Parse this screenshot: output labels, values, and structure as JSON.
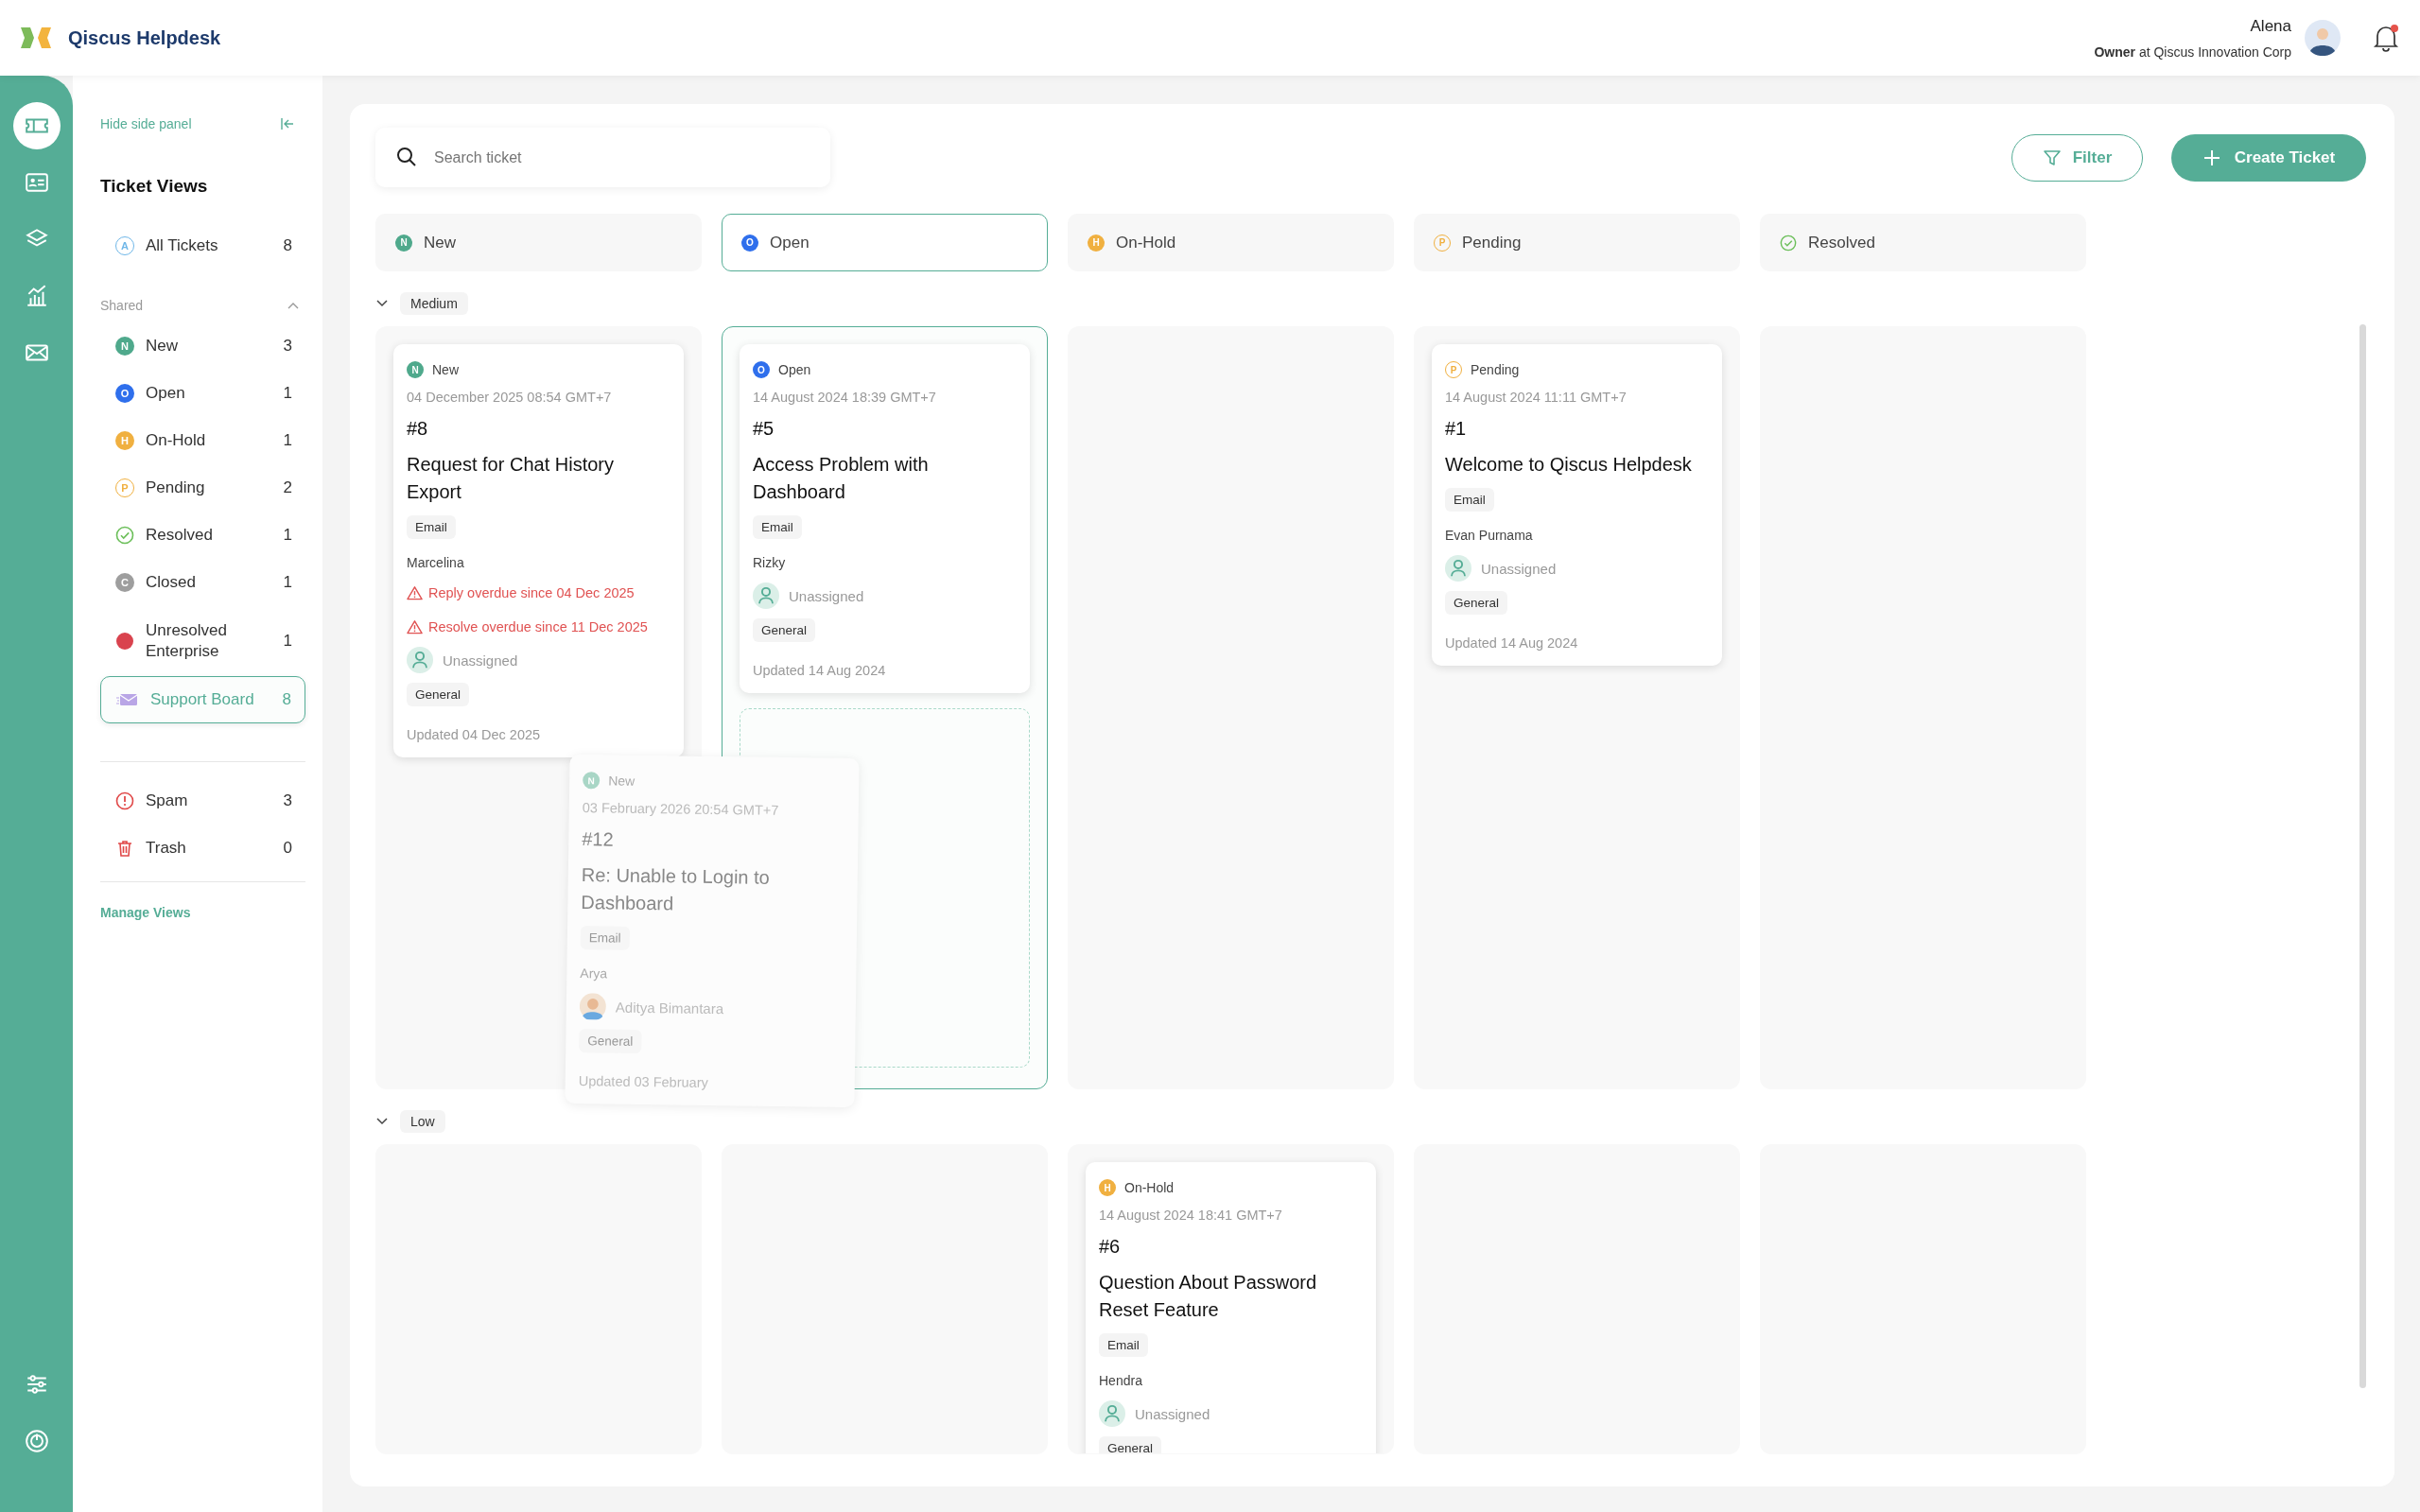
{
  "header": {
    "app_name": "Qiscus Helpdesk",
    "user_name": "Alena",
    "user_role": "**Owner** at Qiscus Innovation Corp",
    "notification_unread": true
  },
  "rail": {
    "items": [
      {
        "kind": "ticket",
        "selected": true
      },
      {
        "kind": "contacts",
        "selected": false
      },
      {
        "kind": "layers",
        "selected": false
      },
      {
        "kind": "chart",
        "selected": false
      },
      {
        "kind": "mail",
        "selected": false
      }
    ],
    "bottom": [
      {
        "kind": "settings"
      },
      {
        "kind": "power"
      }
    ]
  },
  "side_panel": {
    "hide_label": "Hide side panel",
    "title": "Ticket Views",
    "all_tickets": {
      "label": "All Tickets",
      "count": "8",
      "badge": {
        "kind": "outline",
        "letter": "A",
        "color": "#6fb7e8"
      }
    },
    "shared_label": "Shared",
    "shared_expanded": true,
    "views": [
      {
        "label": "New",
        "count": "3",
        "badge": {
          "kind": "filled",
          "letter": "N",
          "color": "#4fa98c"
        }
      },
      {
        "label": "Open",
        "count": "1",
        "badge": {
          "kind": "filled",
          "letter": "O",
          "color": "#2f6fec"
        }
      },
      {
        "label": "On-Hold",
        "count": "1",
        "badge": {
          "kind": "filled",
          "letter": "H",
          "color": "#f0b040"
        }
      },
      {
        "label": "Pending",
        "count": "2",
        "badge": {
          "kind": "outline",
          "letter": "P",
          "color": "#f0b040"
        }
      },
      {
        "label": "Resolved",
        "count": "1",
        "badge": {
          "kind": "check",
          "color": "#6cbf5a"
        }
      },
      {
        "label": "Closed",
        "count": "1",
        "badge": {
          "kind": "filled",
          "letter": "C",
          "color": "#9e9e9e"
        }
      },
      {
        "label": "Unresolved Enterprise",
        "count": "1",
        "badge": {
          "kind": "dot",
          "color": "#d9434e"
        }
      },
      {
        "label": "Support Board",
        "count": "8",
        "badge": {
          "kind": "board",
          "color": "#b9a6e6"
        },
        "selected": true
      }
    ],
    "other": [
      {
        "label": "Spam",
        "count": "3",
        "kind": "spam"
      },
      {
        "label": "Trash",
        "count": "0",
        "kind": "trash"
      }
    ],
    "manage_label": "Manage Views"
  },
  "toolbar": {
    "search": {
      "placeholder": "Search ticket"
    },
    "filter_label": "Filter",
    "create_label": "Create Ticket"
  },
  "columns": [
    {
      "label": "New",
      "selected": false,
      "badge": {
        "kind": "filled",
        "letter": "N",
        "color": "#4fa98c"
      }
    },
    {
      "label": "Open",
      "selected": true,
      "badge": {
        "kind": "filled",
        "letter": "O",
        "color": "#2f6fec"
      }
    },
    {
      "label": "On-Hold",
      "selected": false,
      "badge": {
        "kind": "filled",
        "letter": "H",
        "color": "#f0b040"
      }
    },
    {
      "label": "Pending",
      "selected": false,
      "badge": {
        "kind": "outline",
        "letter": "P",
        "color": "#f0b040"
      }
    },
    {
      "label": "Resolved",
      "selected": false,
      "badge": {
        "kind": "check",
        "color": "#6cbf5a"
      }
    }
  ],
  "groups": [
    {
      "label": "Medium",
      "expanded": true,
      "lanes": [
        {
          "drop_target": false,
          "cards": [
            {
              "status": "New",
              "badge": {
                "kind": "filled",
                "letter": "N",
                "color": "#4fa98c"
              },
              "date": "04 December 2025 08:54 GMT+7",
              "number": "#8",
              "title": "Request for Chat History Export",
              "channel": "Email",
              "requester": "Marcelina",
              "alerts": [
                "Reply overdue since 04 Dec 2025",
                "Resolve overdue since 11 Dec 2025"
              ],
              "assignee": {
                "name": "Unassigned",
                "kind": "unassigned"
              },
              "category": "General",
              "updated": "Updated 04 Dec 2025"
            }
          ]
        },
        {
          "drop_target": true,
          "cards": [
            {
              "status": "Open",
              "badge": {
                "kind": "filled",
                "letter": "O",
                "color": "#2f6fec"
              },
              "date": "14 August 2024 18:39 GMT+7",
              "number": "#5",
              "title": "Access Problem with Dashboard",
              "channel": "Email",
              "requester": "Rizky",
              "assignee": {
                "name": "Unassigned",
                "kind": "unassigned"
              },
              "category": "General",
              "updated": "Updated 14 Aug 2024"
            }
          ]
        },
        {
          "drop_target": false
        },
        {
          "drop_target": false,
          "cards": [
            {
              "status": "Pending",
              "badge": {
                "kind": "outline",
                "letter": "P",
                "color": "#f0b040"
              },
              "date": "14 August 2024 11:11 GMT+7",
              "number": "#1",
              "title": "Welcome to Qiscus Helpdesk",
              "channel": "Email",
              "requester": "Evan Purnama",
              "assignee": {
                "name": "Unassigned",
                "kind": "unassigned"
              },
              "category": "General",
              "updated": "Updated 14 Aug 2024"
            }
          ]
        },
        {
          "drop_target": false
        }
      ]
    },
    {
      "label": "Low",
      "expanded": true,
      "lanes": [
        {
          "drop_target": false
        },
        {
          "drop_target": false
        },
        {
          "drop_target": false,
          "cards": [
            {
              "status": "On-Hold",
              "badge": {
                "kind": "filled",
                "letter": "H",
                "color": "#f0b040"
              },
              "date": "14 August 2024 18:41 GMT+7",
              "number": "#6",
              "title": "Question About Password Reset Feature",
              "channel": "Email",
              "requester": "Hendra",
              "assignee": {
                "name": "Unassigned",
                "kind": "unassigned"
              },
              "category": "General"
            }
          ]
        },
        {
          "drop_target": false
        },
        {
          "drop_target": false
        }
      ]
    }
  ],
  "dragged_card": {
    "status": "New",
    "badge": {
      "kind": "filled",
      "letter": "N",
      "color": "#a9d6c6"
    },
    "date": "03 February 2026 20:54 GMT+7",
    "number": "#12",
    "title": "Re: Unable to Login to Dashboard",
    "channel": "Email",
    "requester": "Arya",
    "assignee": {
      "name": "Aditya Bimantara",
      "kind": "agent"
    },
    "category": "General",
    "updated": "Updated 03 February"
  }
}
